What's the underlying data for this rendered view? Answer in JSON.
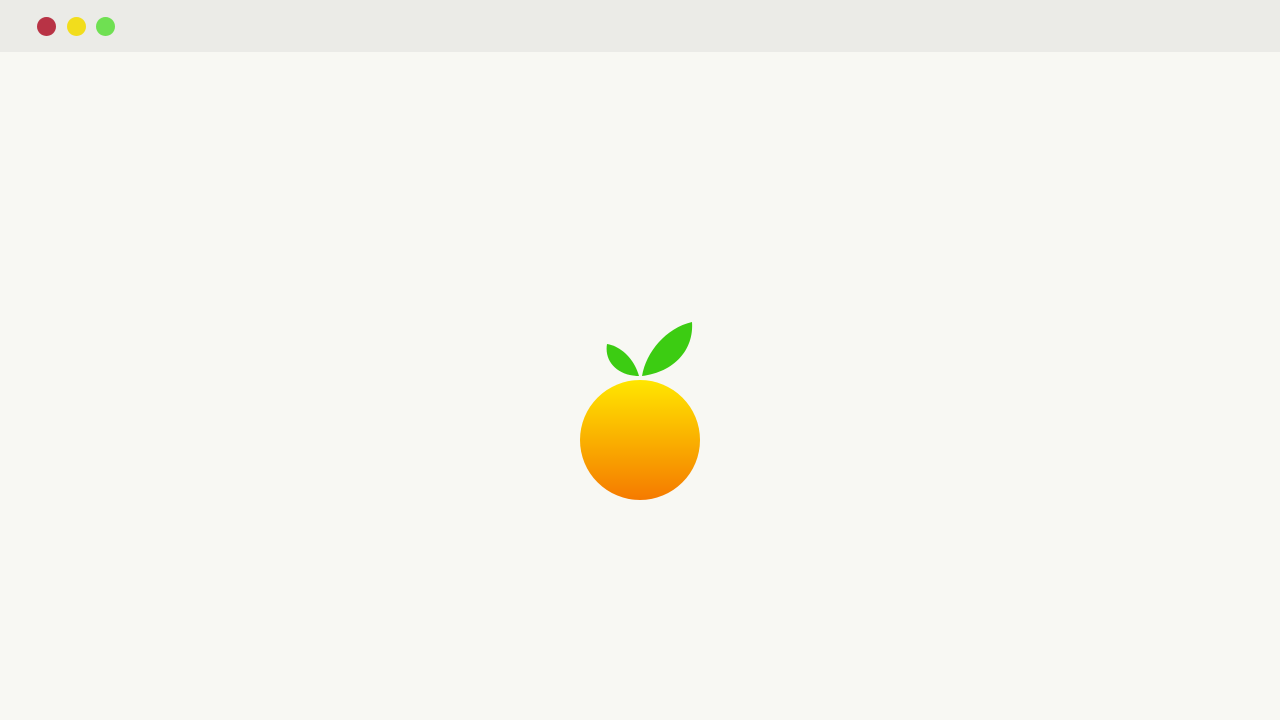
{
  "window": {
    "background": "#f8f8f3",
    "titlebar_color": "#ebebe7",
    "controls": [
      {
        "name": "close",
        "icon": "close-dot-icon",
        "color": "#b83345"
      },
      {
        "name": "minimize",
        "icon": "minimize-dot-icon",
        "color": "#f2dd1c"
      },
      {
        "name": "zoom",
        "icon": "zoom-dot-icon",
        "color": "#6fe052"
      }
    ]
  },
  "splash": {
    "logo_icon": "orange-fruit-logo-icon",
    "colors": {
      "fruit_top": "#ffe600",
      "fruit_bottom": "#f57a00",
      "leaf": "#3ccc12"
    }
  }
}
